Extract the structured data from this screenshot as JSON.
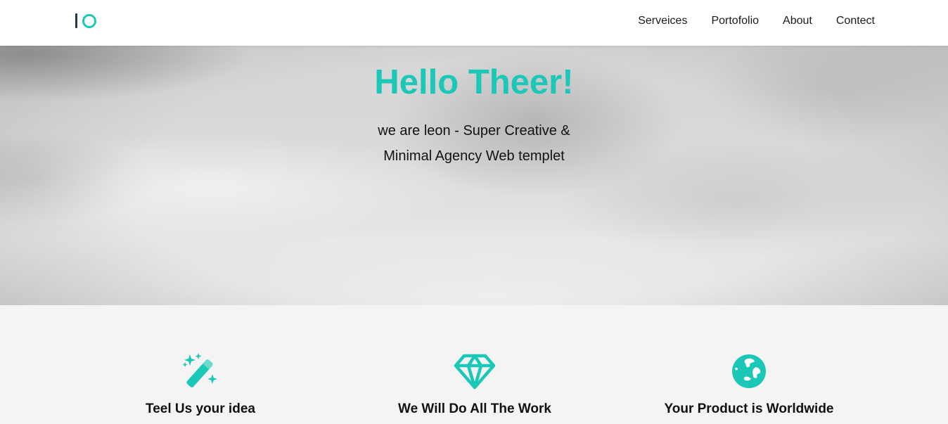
{
  "header": {
    "logo_alt": "IO",
    "nav": {
      "services": "Serveices",
      "portfolio": "Portofolio",
      "about": "About",
      "contact": "Contect"
    }
  },
  "hero": {
    "title": "Hello Theer!",
    "subtitle_line1": "we are leon - Super Creative &",
    "subtitle_line2": "Minimal Agency Web templet"
  },
  "features": {
    "items": [
      {
        "icon": "magic-wand-icon",
        "label": "Teel Us your idea"
      },
      {
        "icon": "diamond-icon",
        "label": "We Will Do All The Work"
      },
      {
        "icon": "globe-icon",
        "label": "Your Product is Worldwide"
      }
    ]
  },
  "colors": {
    "accent": "#1bc7b6",
    "logo_dark": "#1c3b4a",
    "header_bg": "#ffffff",
    "features_bg": "#f4f4f4"
  }
}
